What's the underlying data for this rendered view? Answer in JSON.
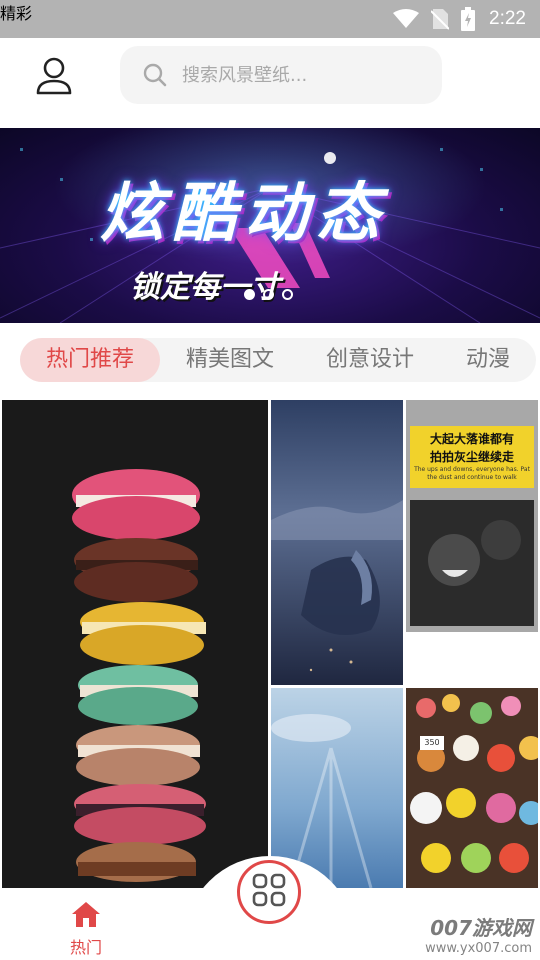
{
  "status_bar": {
    "time": "2:22"
  },
  "header": {
    "search": {
      "placeholder": "搜索风景壁纸..."
    }
  },
  "banner": {
    "title": "炫酷动态",
    "subtitle": "锁定每一寸",
    "highlight": "精彩",
    "pages": 3,
    "active_page": 1
  },
  "tabs": [
    {
      "label": "热门推荐",
      "active": true
    },
    {
      "label": "精美图文",
      "active": false
    },
    {
      "label": "创意设计",
      "active": false
    },
    {
      "label": "动漫",
      "active": false
    }
  ],
  "grid": {
    "meme_caption": {
      "line1": "大起大落谁都有",
      "line2": "拍拍灰尘继续走",
      "english": "The ups and downs, everyone has. Pat the dust and continue to walk"
    },
    "price_tags": [
      "350"
    ]
  },
  "bottom_nav": {
    "hot": {
      "label": "热门"
    },
    "center": {
      "icon": "apps-grid-icon"
    }
  },
  "watermark": {
    "line1": "007游戏网",
    "line2": "www.yx007.com"
  },
  "colors": {
    "accent": "#e04848",
    "tab_active_bg": "#f7d8d8",
    "search_bg": "#f4f4f4",
    "status_bar": "#b3b3b3"
  }
}
